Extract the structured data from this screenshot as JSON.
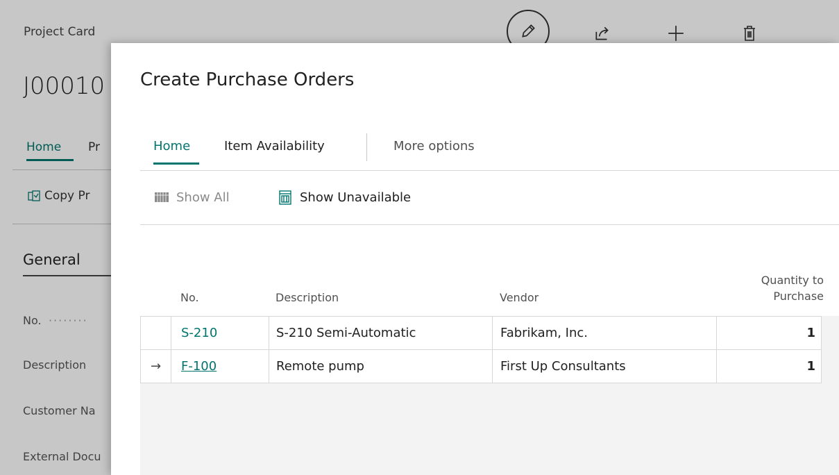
{
  "background_page": {
    "breadcrumb": "Project Card",
    "title": "J00010",
    "tabs": [
      "Home",
      "Pr"
    ],
    "copy_action": "Copy Pr",
    "section": "General",
    "fields": [
      "No.",
      "Description",
      "Customer Na",
      "External Docu"
    ],
    "actions": {
      "edit": "pencil-icon",
      "share": "share-icon",
      "new": "plus-icon",
      "delete": "trash-icon"
    }
  },
  "dialog": {
    "title": "Create Purchase Orders",
    "tabs": {
      "home": "Home",
      "item_availability": "Item Availability",
      "more_options": "More options"
    },
    "actions": {
      "show_all": "Show All",
      "show_unavailable": "Show Unavailable"
    },
    "table": {
      "columns": {
        "no": "No.",
        "description": "Description",
        "vendor": "Vendor",
        "qty": "Quantity to Purchase"
      },
      "rows": [
        {
          "indicator": "",
          "no": "S-210",
          "description": "S-210 Semi-Automatic",
          "vendor": "Fabrikam, Inc.",
          "qty": "1"
        },
        {
          "indicator": "→",
          "no": "F-100",
          "description": "Remote pump",
          "vendor": "First Up Consultants",
          "qty": "1"
        }
      ]
    }
  },
  "colors": {
    "accent": "#00756e",
    "text": "#212121",
    "disabled": "#8a8a8a"
  }
}
